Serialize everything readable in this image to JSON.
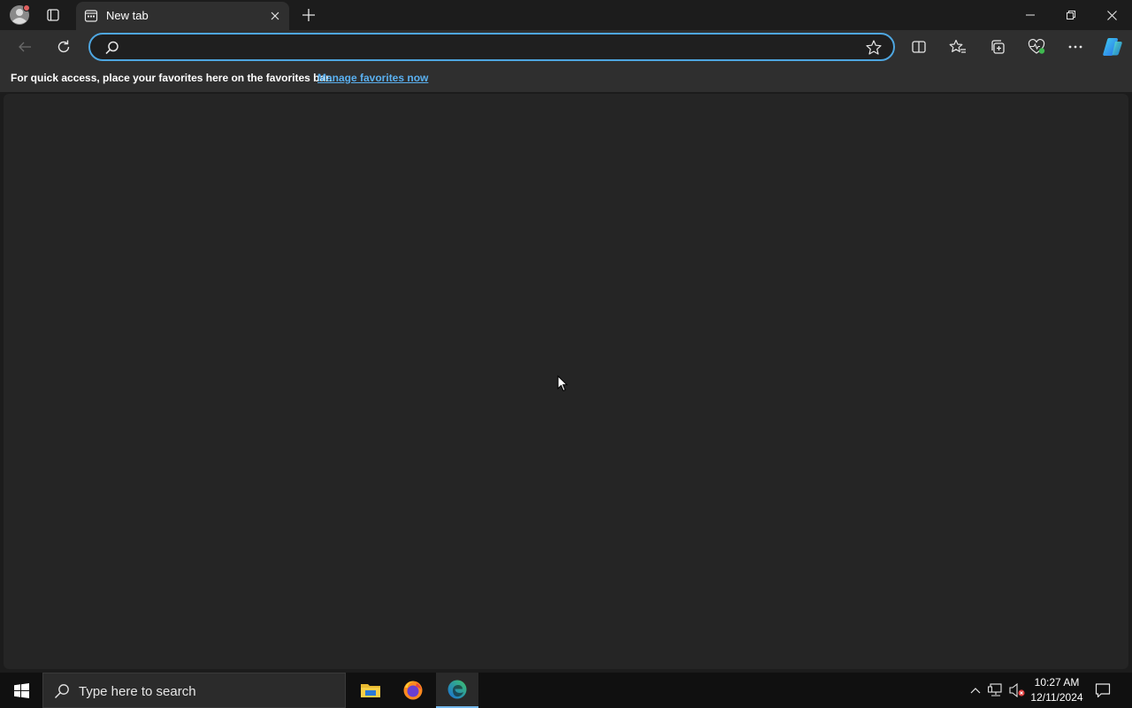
{
  "browser": {
    "tab": {
      "title": "New tab"
    },
    "address": {
      "value": "",
      "placeholder": ""
    },
    "favorites_bar": {
      "message": "For quick access, place your favorites here on the favorites bar.",
      "link": "Manage favorites now"
    },
    "icons": {
      "profile": "profile-icon",
      "tab_actions": "tab-actions-icon",
      "new_tab": "plus-icon",
      "back": "arrow-left-icon",
      "refresh": "refresh-icon",
      "search": "search-icon",
      "favorite": "star-icon",
      "split_screen": "split-screen-icon",
      "favorites": "favorites-icon",
      "collections": "collections-icon",
      "browser_essentials": "heart-pulse-icon",
      "more": "ellipsis-icon",
      "copilot": "copilot-icon"
    }
  },
  "taskbar": {
    "search_placeholder": "Type here to search",
    "time": "10:27 AM",
    "date": "12/11/2024",
    "apps": [
      "file-explorer",
      "firefox",
      "edge"
    ],
    "active_app": "edge"
  },
  "colors": {
    "accent": "#4ea6e0",
    "link": "#5ab0f0",
    "chrome_bg": "#2f2f2f",
    "titlebar_bg": "#1c1c1c",
    "content_bg": "#252525",
    "taskbar_bg": "#101010"
  }
}
